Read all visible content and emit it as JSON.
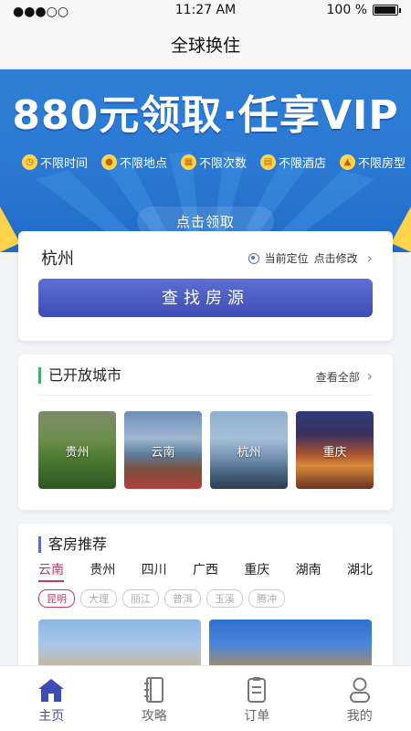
{
  "status": {
    "signal": "●●●○○",
    "time": "11:27 AM",
    "battery": "100 %",
    "battery_level": 1.0
  },
  "nav": {
    "title": "全球换住"
  },
  "banner": {
    "headline": "880元领取·任享VIP",
    "features": [
      "不限时间",
      "不限地点",
      "不限次数",
      "不限酒店",
      "不限房型"
    ],
    "cta": "点击领取"
  },
  "search": {
    "city": "杭州",
    "locate_label": "当前定位",
    "modify_label": "点击修改",
    "button_label": "查找房源"
  },
  "open_cities": {
    "title": "已开放城市",
    "view_all": "查看全部",
    "cities": [
      "贵州",
      "云南",
      "杭州",
      "重庆"
    ]
  },
  "rooms": {
    "title": "客房推荐",
    "provinces": [
      "云南",
      "贵州",
      "四川",
      "广西",
      "重庆",
      "湖南",
      "湖北"
    ],
    "cities": [
      "昆明",
      "大理",
      "丽江",
      "普洱",
      "玉溪",
      "腾冲"
    ]
  },
  "tabbar": {
    "home": "主页",
    "guide": "攻略",
    "orders": "订单",
    "mine": "我的"
  },
  "colors": {
    "accent": "#3e4db3",
    "highlight": "#c03a5b",
    "banner": "#2a78d2"
  }
}
